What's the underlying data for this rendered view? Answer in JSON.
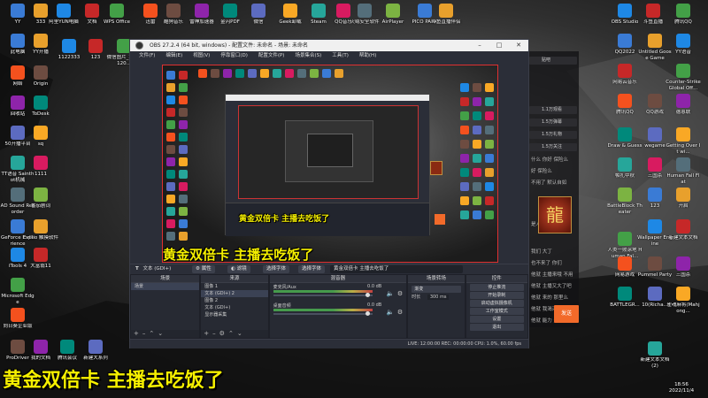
{
  "desktop": {
    "top_row": [
      "YY",
      "333",
      "阿里YUN电脑",
      "文档",
      "WPS Office",
      "迅雷",
      "酷狗音乐",
      "雷神加速器",
      "金闪PDF",
      "微信",
      "Geek卸载",
      "Steam",
      "QQ音乐",
      "火绒安全软件",
      "AirPlayer",
      "PICO PARK",
      "斗鱼直播伴侣",
      "OBS Studio",
      "斗鱼直播",
      "腾讯QQ"
    ],
    "left_col": [
      "此电脑",
      "YY开播",
      "1122333",
      "123",
      "微信图片_2021120...",
      "网络",
      "Origin",
      "回收站",
      "ToDesk",
      "50开播平台",
      "sq",
      "TT语音 Sainthot机械",
      "1111",
      "AD Sound Recorder",
      "番茄剧词",
      "GeForce Experience",
      "Evillio 触摸软件",
      "iTools 4",
      "大富翁11",
      "Microsoft Edge",
      "向日葵企业版",
      "ProDriver",
      "我的文档",
      "腾讯会议",
      "新建大系列"
    ],
    "right_col": [
      "QQ2022",
      "Untitled Goose Game",
      "YY语音",
      "网易云音乐",
      "Counter-Strike Global Off...",
      "腾讯QQ",
      "QQ游戏",
      "德恩联",
      "Draw & Guess",
      "wegame",
      "Getting Over It wi...",
      "帕扎中秋",
      "三国杀",
      "Human Fall Flat",
      "BattleBlock Theater",
      "123",
      "开启",
      "Wallpaper Engine",
      "新建文本文档",
      "人类一败涂地 Human Fal...",
      "网易游戏",
      "Pummel Party",
      "三国杀",
      "BATTLEGR...",
      "10(Richa...",
      "雀魂麻将(Mahjong...",
      "新建文本文档(2)"
    ]
  },
  "obs": {
    "title": "OBS 27.2.4 (64 bit, windows) - 配置文件: 未命名 - 场景: 未命名",
    "menu": [
      "文件(F)",
      "编辑(E)",
      "视图(V)",
      "停靠窗口(D)",
      "配置文件(P)",
      "场景集合(S)",
      "工具(T)",
      "帮助(H)"
    ],
    "source_toolbar": {
      "label": "文本 (GDI+)",
      "properties": "属性",
      "filters": "滤镜",
      "font": "选择字体",
      "text_value": "黄金双倍卡 主播去吃饭了"
    },
    "docks": {
      "scenes": {
        "title": "场景",
        "items": [
          "场景"
        ]
      },
      "sources": {
        "title": "来源",
        "items": [
          "图像 1",
          "文本 (GDI+) 2",
          "图像 2",
          "文本 (GDI+)",
          "显示器采集"
        ]
      },
      "mixer": {
        "title": "混音器",
        "tracks": [
          {
            "name": "麦克风/Aux",
            "db": "0.0 dB"
          },
          {
            "name": "桌面音频",
            "db": "0.0 dB"
          }
        ]
      },
      "transitions": {
        "title": "场景转场",
        "type": "渐变",
        "duration_label": "时长",
        "duration": "300 ms"
      },
      "controls": {
        "title": "控件",
        "buttons": [
          "停止推流",
          "开始录制",
          "启动虚拟摄像机",
          "工作室模式",
          "设置",
          "退出"
        ]
      }
    },
    "status": "LIVE: 12:00:00   REC: 00:00:00   CPU: 1.0%, 60.00 fps"
  },
  "captions": {
    "main": "黄金双倍卡 主播去吃饭了",
    "preview_l1": "黄金双倍卡 主播去吃饭了",
    "preview_l2": "黄金双倍卡 主播去吃饭了"
  },
  "chat": {
    "tabs": [
      "贴吧",
      "1.1万观看",
      "1.5万弹幕",
      "1.5万礼物",
      "1.5万关注"
    ],
    "lines": [
      "什么 你好 保险么",
      "好 保险么",
      "不用了 默认自如",
      "是人 默认人",
      "我们 大丁",
      "也不来了 你们",
      "他就 主播来哦 不用",
      "他就 主播又大了吧",
      "他就 来的 那里么",
      "他就 我渴渴 人喝",
      "他就 能力 是吧"
    ],
    "send": "发送",
    "badge": "龍"
  },
  "clock": {
    "time": "18:56",
    "date": "2022/11/4"
  }
}
